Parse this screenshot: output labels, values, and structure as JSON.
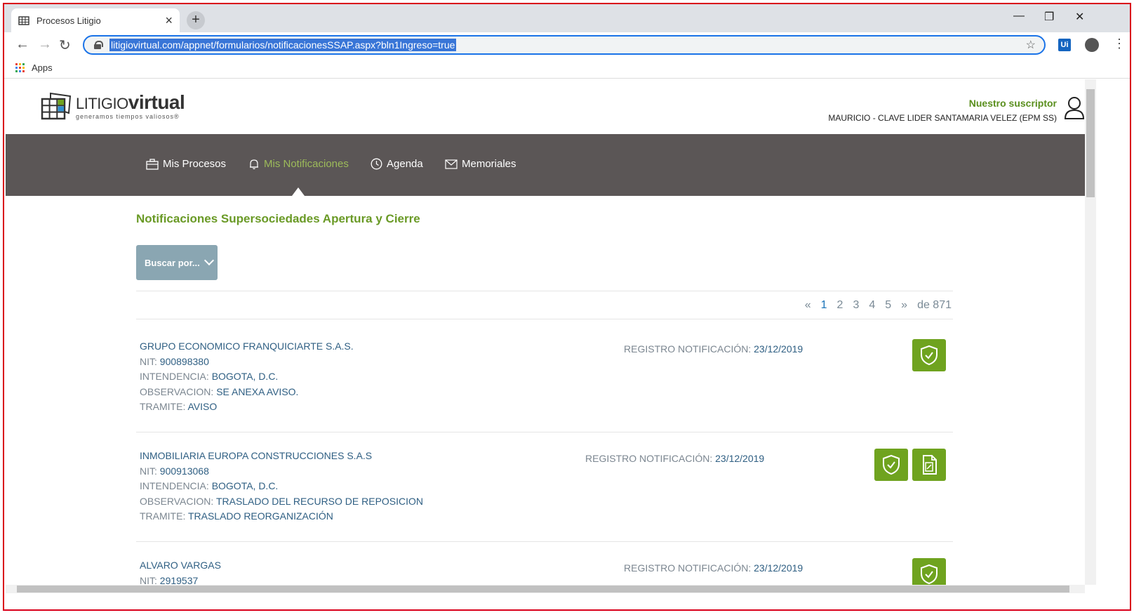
{
  "browser": {
    "tab_title": "Procesos Litigio",
    "url": "litigiovirtual.com/appnet/formularios/notificacionesSSAP.aspx?bln1Ingreso=true",
    "bookmarks_apps": "Apps",
    "extension_label": "Ui"
  },
  "site": {
    "logo_light": "LITIGIO",
    "logo_bold": "virtual",
    "logo_tagline": "generamos tiempos valiosos®",
    "subscriber_label": "Nuestro suscriptor",
    "subscriber_name": "MAURICIO - CLAVE LIDER SANTAMARIA VELEZ (EPM SS)"
  },
  "nav": {
    "items": [
      {
        "label": "Mis Procesos",
        "icon": "briefcase-icon"
      },
      {
        "label": "Mis Notificaciones",
        "icon": "bell-icon",
        "active": true
      },
      {
        "label": "Agenda",
        "icon": "clock-icon"
      },
      {
        "label": "Memoriales",
        "icon": "envelope-icon"
      }
    ]
  },
  "main": {
    "title": "Notificaciones Supersociedades Apertura y Cierre",
    "search_label": "Buscar por...",
    "pager": {
      "prev": "«",
      "pages": [
        "1",
        "2",
        "3",
        "4",
        "5"
      ],
      "current": "1",
      "next": "»",
      "total": "de 871"
    },
    "labels": {
      "nit": "NIT: ",
      "intendencia": "INTENDENCIA: ",
      "observacion": "OBSERVACION: ",
      "tramite": "TRAMITE: ",
      "registro": "REGISTRO NOTIFICACIÓN: "
    },
    "records": [
      {
        "company": "GRUPO ECONOMICO FRANQUICIARTE S.A.S.",
        "nit": "900898380",
        "intendencia": "BOGOTA, D.C.",
        "observacion": "SE ANEXA AVISO.",
        "tramite": "AVISO",
        "registro": "23/12/2019"
      },
      {
        "company": "INMOBILIARIA EUROPA CONSTRUCCIONES S.A.S",
        "nit": "900913068",
        "intendencia": "BOGOTA, D.C.",
        "observacion": "TRASLADO DEL RECURSO DE REPOSICION",
        "tramite": "TRASLADO REORGANIZACIÓN",
        "registro": "23/12/2019"
      },
      {
        "company": "ALVARO VARGAS",
        "nit": "2919537",
        "registro": "23/12/2019"
      }
    ]
  },
  "colors": {
    "accent_green": "#6fa31f",
    "nav_bg": "#5b5656",
    "title_green": "#6a9a26",
    "value_blue": "#2f5f83"
  }
}
